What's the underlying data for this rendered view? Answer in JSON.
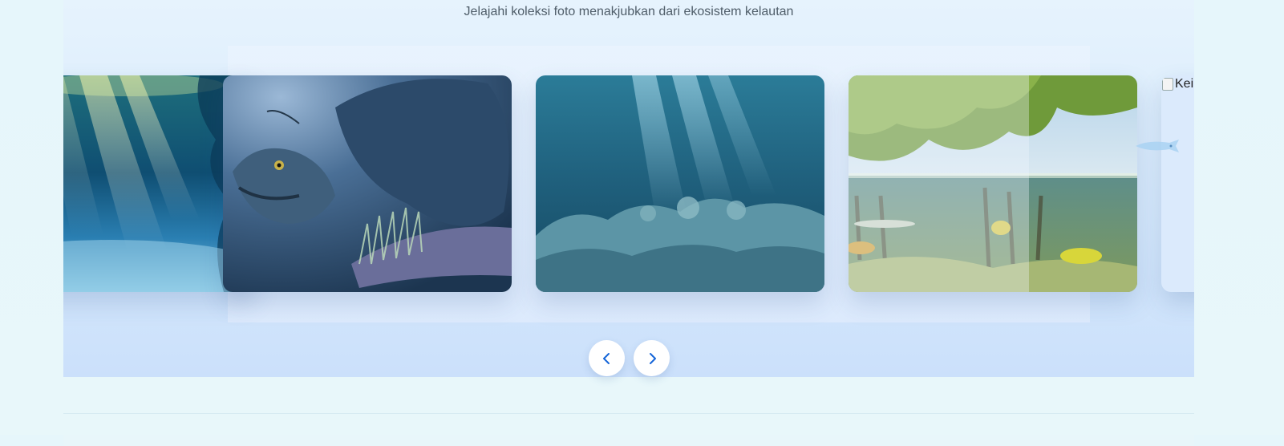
{
  "gallery": {
    "subtitle": "Jelajahi koleksi foto menakjubkan dari ekosistem kelautan",
    "slides": [
      {
        "name": "sunlit-reef",
        "alt": ""
      },
      {
        "name": "anglerfish",
        "alt": ""
      },
      {
        "name": "coral-reef",
        "alt": ""
      },
      {
        "name": "mangrove",
        "alt": ""
      },
      {
        "name": "broken-image",
        "alt": "Keir"
      }
    ],
    "prev_icon": "chevron-left-icon",
    "next_icon": "chevron-right-icon",
    "accent": "#1565d8"
  }
}
